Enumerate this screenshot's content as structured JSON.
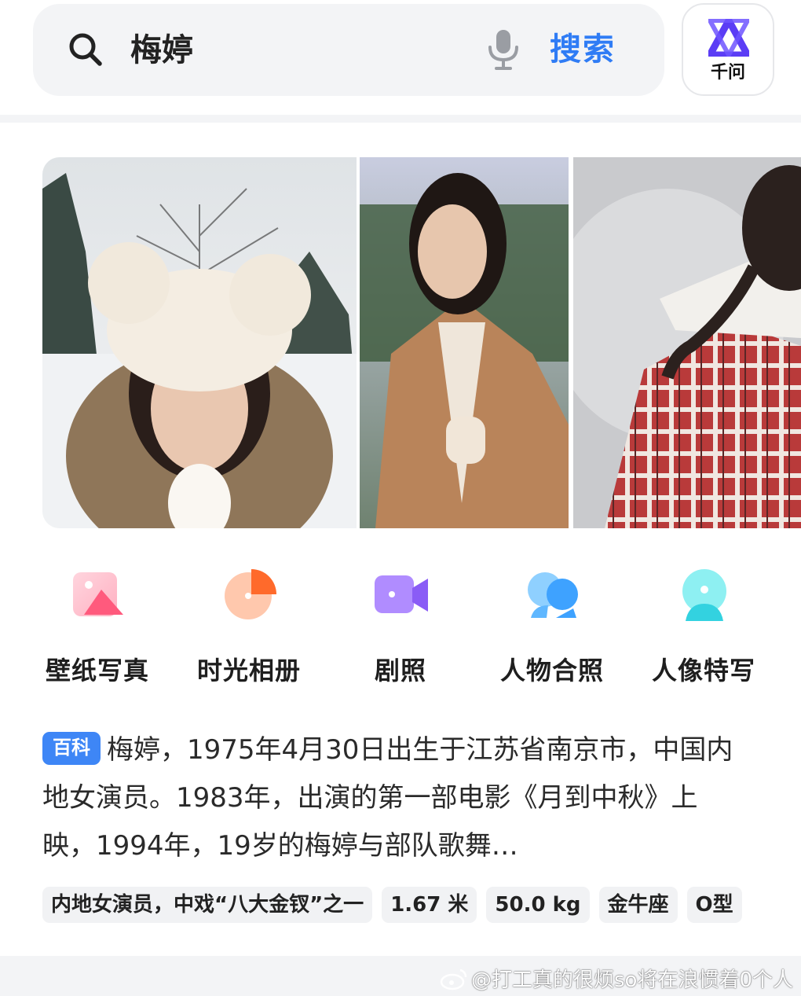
{
  "search": {
    "query": "梅婷",
    "button_label": "搜索",
    "assistant_label": "千问",
    "accent_color": "#2f7cf5"
  },
  "photos": [
    {
      "name": "photo-snow-selfie"
    },
    {
      "name": "photo-camel-coat"
    },
    {
      "name": "photo-plaid-coat"
    }
  ],
  "categories": [
    {
      "label": "壁纸写真",
      "icon": "picture-icon"
    },
    {
      "label": "时光相册",
      "icon": "pie-icon"
    },
    {
      "label": "剧照",
      "icon": "video-camera-icon"
    },
    {
      "label": "人物合照",
      "icon": "group-chat-icon"
    },
    {
      "label": "人像特写",
      "icon": "portrait-icon"
    }
  ],
  "baike": {
    "badge": "百科",
    "text": "梅婷，1975年4月30日出生于江苏省南京市，中国内地女演员。1983年，出演的第一部电影《月到中秋》上映，1994年，19岁的梅婷与部队歌舞…",
    "tags": [
      "内地女演员，中戏“八大金钗”之一",
      "1.67 米",
      "50.0 kg",
      "金牛座",
      "O型"
    ]
  },
  "watermark": "@打工真的很烦so将在浪惯着0个人"
}
